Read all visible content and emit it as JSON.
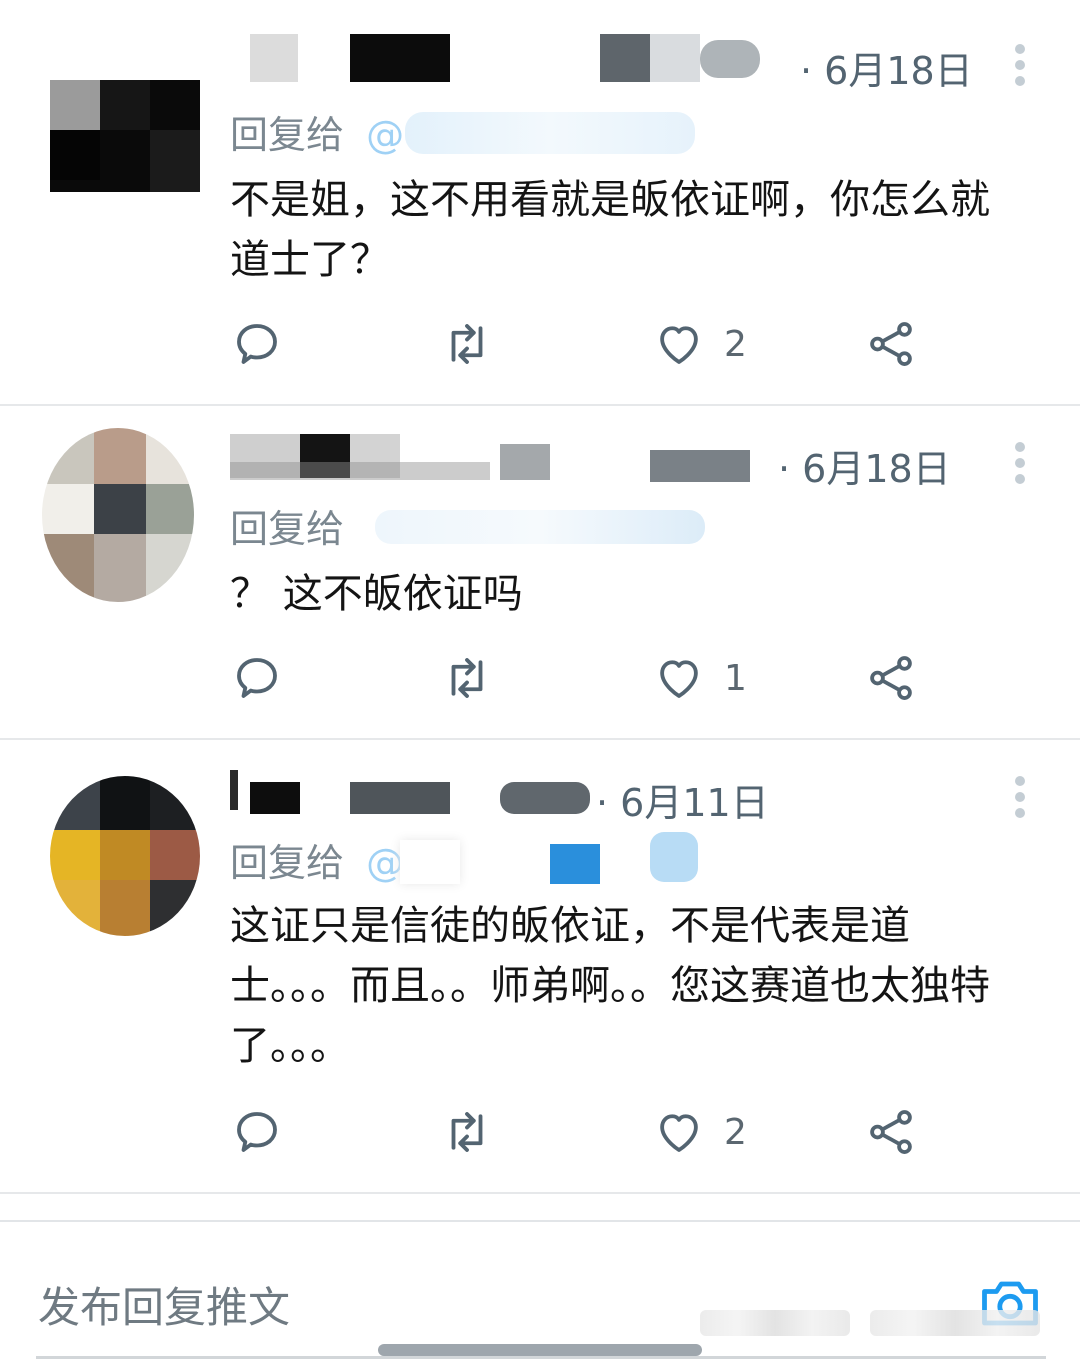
{
  "tweets": [
    {
      "date": "· 6月18日",
      "reply_prefix": "回复给",
      "mention_prefix": "@",
      "text": "不是姐，这不用看就是皈依证啊，你怎么就道士了？",
      "actions": {
        "reply_count": "",
        "retweet_count": "",
        "like_count": "2"
      }
    },
    {
      "date": "· 6月18日",
      "reply_prefix": "回复给",
      "mention_prefix": "",
      "text": "？ 这不皈依证吗",
      "actions": {
        "reply_count": "",
        "retweet_count": "",
        "like_count": "1"
      }
    },
    {
      "date": "· 6月11日",
      "reply_prefix": "回复给",
      "mention_prefix": "@",
      "text": "这证只是信徒的皈依证，不是代表是道士。。。而且。。师弟啊。。您这赛道也太独特了。。。",
      "actions": {
        "reply_count": "",
        "retweet_count": "",
        "like_count": "2"
      }
    }
  ],
  "compose": {
    "placeholder": "发布回复推文"
  },
  "icons": [
    "more-icon",
    "reply-icon",
    "retweet-icon",
    "like-icon",
    "share-icon",
    "camera-icon"
  ],
  "colors": {
    "accent": "#1d9bf0",
    "muted_text": "#536471",
    "icon": "#536471",
    "divider": "#e6e8ea"
  }
}
